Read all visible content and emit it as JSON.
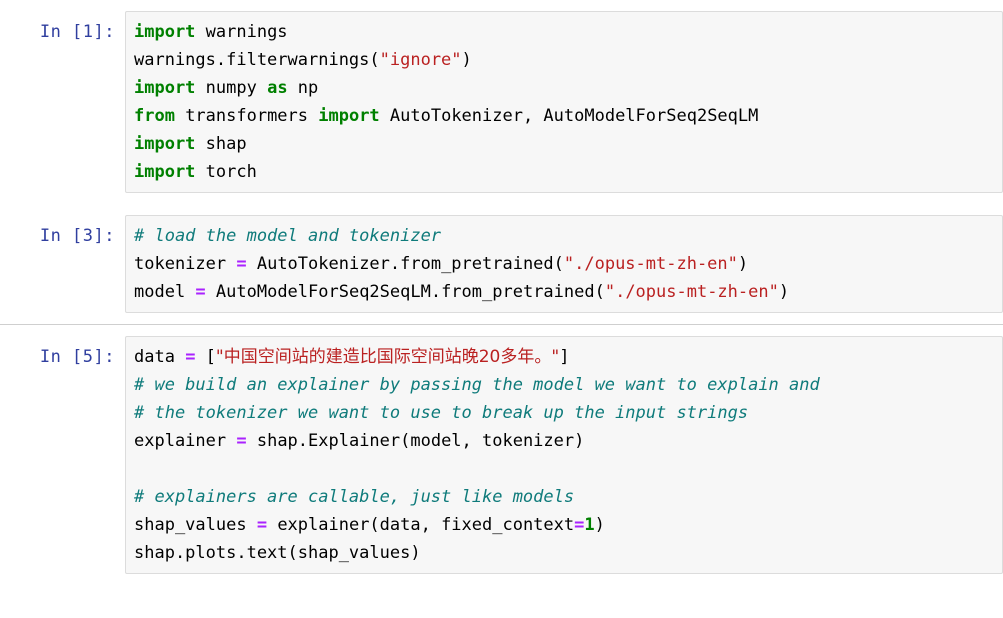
{
  "notebook": {
    "cells": [
      {
        "prompt": "In [1]:",
        "lines": [
          [
            {
              "t": "kw",
              "s": "import"
            },
            {
              "t": "plain",
              "s": " warnings"
            }
          ],
          [
            {
              "t": "plain",
              "s": "warnings.filterwarnings("
            },
            {
              "t": "str",
              "s": "\"ignore\""
            },
            {
              "t": "plain",
              "s": ")"
            }
          ],
          [
            {
              "t": "kw",
              "s": "import"
            },
            {
              "t": "plain",
              "s": " numpy "
            },
            {
              "t": "kw",
              "s": "as"
            },
            {
              "t": "plain",
              "s": " np"
            }
          ],
          [
            {
              "t": "kw",
              "s": "from"
            },
            {
              "t": "plain",
              "s": " transformers "
            },
            {
              "t": "kw",
              "s": "import"
            },
            {
              "t": "plain",
              "s": " AutoTokenizer, AutoModelForSeq2SeqLM"
            }
          ],
          [
            {
              "t": "kw",
              "s": "import"
            },
            {
              "t": "plain",
              "s": " shap"
            }
          ],
          [
            {
              "t": "kw",
              "s": "import"
            },
            {
              "t": "plain",
              "s": " torch"
            }
          ]
        ]
      },
      {
        "prompt": "In [3]:",
        "lines": [
          [
            {
              "t": "com",
              "s": "# load the model and tokenizer"
            }
          ],
          [
            {
              "t": "plain",
              "s": "tokenizer "
            },
            {
              "t": "op",
              "s": "="
            },
            {
              "t": "plain",
              "s": " AutoTokenizer.from_pretrained("
            },
            {
              "t": "str",
              "s": "\"./opus-mt-zh-en\""
            },
            {
              "t": "plain",
              "s": ")"
            }
          ],
          [
            {
              "t": "plain",
              "s": "model "
            },
            {
              "t": "op",
              "s": "="
            },
            {
              "t": "plain",
              "s": " AutoModelForSeq2SeqLM.from_pretrained("
            },
            {
              "t": "str",
              "s": "\"./opus-mt-zh-en\""
            },
            {
              "t": "plain",
              "s": ")"
            }
          ]
        ]
      },
      {
        "prompt": "In [5]:",
        "lines": [
          [
            {
              "t": "plain",
              "s": "data "
            },
            {
              "t": "op",
              "s": "="
            },
            {
              "t": "plain",
              "s": " ["
            },
            {
              "t": "str",
              "s": "\"中国空间站的建造比国际空间站晚20多年。\""
            },
            {
              "t": "plain",
              "s": "]"
            }
          ],
          [
            {
              "t": "com",
              "s": "# we build an explainer by passing the model we want to explain and"
            }
          ],
          [
            {
              "t": "com",
              "s": "# the tokenizer we want to use to break up the input strings"
            }
          ],
          [
            {
              "t": "plain",
              "s": "explainer "
            },
            {
              "t": "op",
              "s": "="
            },
            {
              "t": "plain",
              "s": " shap.Explainer(model, tokenizer)"
            }
          ],
          [],
          [
            {
              "t": "com",
              "s": "# explainers are callable, just like models"
            }
          ],
          [
            {
              "t": "plain",
              "s": "shap_values "
            },
            {
              "t": "op",
              "s": "="
            },
            {
              "t": "plain",
              "s": " explainer(data, fixed_context"
            },
            {
              "t": "op",
              "s": "="
            },
            {
              "t": "num",
              "s": "1"
            },
            {
              "t": "plain",
              "s": ")"
            }
          ],
          [
            {
              "t": "plain",
              "s": "shap.plots.text(shap_values)"
            }
          ]
        ]
      }
    ],
    "colors": {
      "keyword": "#008000",
      "string": "#ba2121",
      "comment": "#0f7b7b",
      "operator": "#aa22ff",
      "number": "#008000",
      "prompt": "#303f9f",
      "cell_background": "#f7f7f7",
      "cell_border": "#dcdcdc",
      "page_background": "#ffffff"
    }
  }
}
